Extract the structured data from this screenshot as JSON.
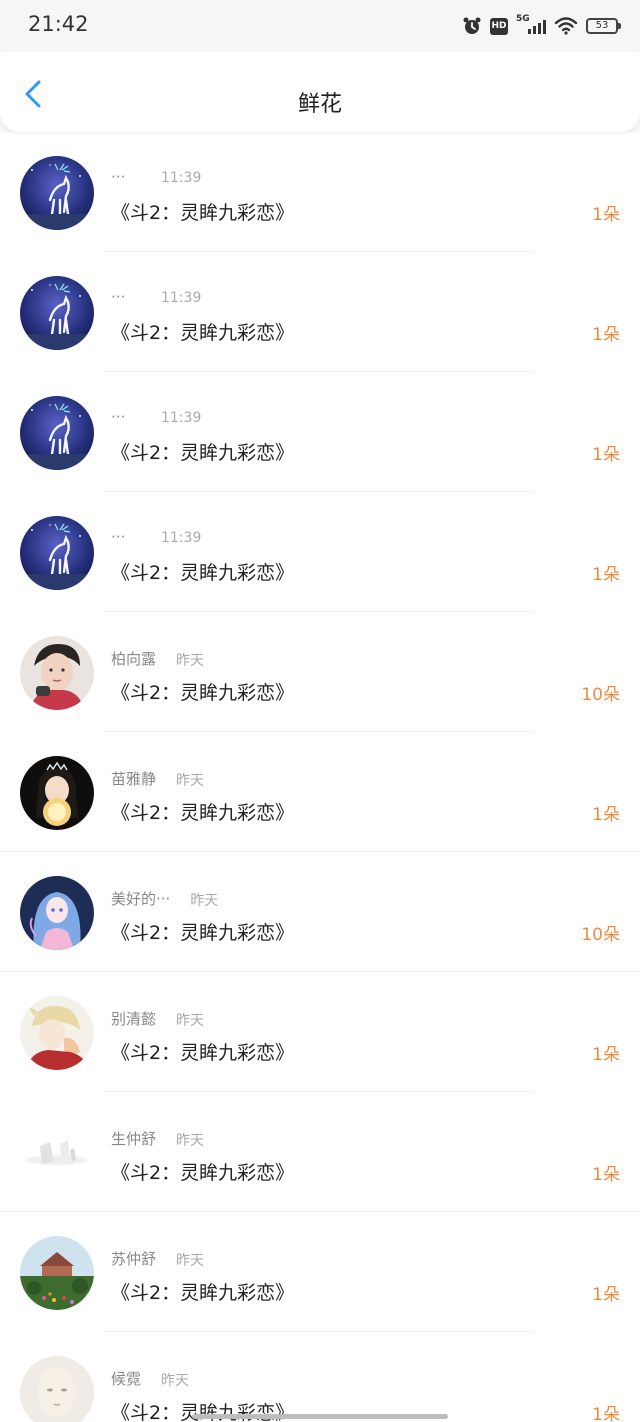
{
  "status_bar": {
    "time": "21:42",
    "network_label": "5G",
    "hd_label": "HD",
    "battery_level": "53",
    "icons": [
      "alarm-icon",
      "hd-icon",
      "signal-icon",
      "wifi-icon",
      "battery-icon"
    ]
  },
  "header": {
    "title": "鲜花",
    "back_icon": "chevron-left-icon",
    "accent_color": "#2b9cf0"
  },
  "count_color": "#f08a3c",
  "items": [
    {
      "name": "···",
      "time": "11:39",
      "book": "《斗2：灵眸九彩恋》",
      "count": "1朵",
      "avatar": "deer-night-avatar"
    },
    {
      "name": "···",
      "time": "11:39",
      "book": "《斗2：灵眸九彩恋》",
      "count": "1朵",
      "avatar": "deer-night-avatar"
    },
    {
      "name": "···",
      "time": "11:39",
      "book": "《斗2：灵眸九彩恋》",
      "count": "1朵",
      "avatar": "deer-night-avatar"
    },
    {
      "name": "···",
      "time": "11:39",
      "book": "《斗2：灵眸九彩恋》",
      "count": "1朵",
      "avatar": "deer-night-avatar"
    },
    {
      "name": "柏向露",
      "time": "昨天",
      "book": "《斗2：灵眸九彩恋》",
      "count": "10朵",
      "avatar": "boy-photo-avatar"
    },
    {
      "name": "苗雅静",
      "time": "昨天",
      "book": "《斗2：灵眸九彩恋》",
      "count": "1朵",
      "avatar": "girl-glow-avatar"
    },
    {
      "name": "美好的···",
      "time": "昨天",
      "book": "《斗2：灵眸九彩恋》",
      "count": "10朵",
      "avatar": "anime-girl-avatar"
    },
    {
      "name": "别清懿",
      "time": "昨天",
      "book": "《斗2：灵眸九彩恋》",
      "count": "1朵",
      "avatar": "anime-elf-avatar"
    },
    {
      "name": "生仲舒",
      "time": "昨天",
      "book": "《斗2：灵眸九彩恋》",
      "count": "1朵",
      "avatar": "sketch-avatar"
    },
    {
      "name": "苏仲舒",
      "time": "昨天",
      "book": "《斗2：灵眸九彩恋》",
      "count": "1朵",
      "avatar": "garden-house-avatar"
    },
    {
      "name": "候霓",
      "time": "昨天",
      "book": "《斗2：灵眸九彩恋》",
      "count": "1朵",
      "avatar": "pale-face-avatar"
    }
  ]
}
